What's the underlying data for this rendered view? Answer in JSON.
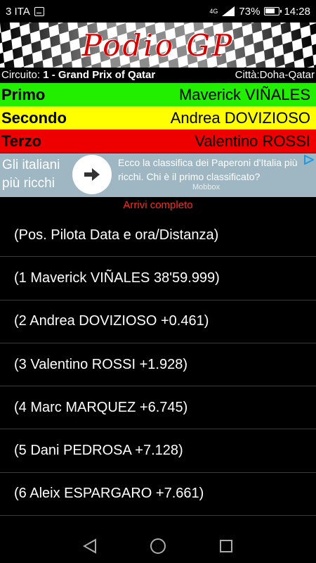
{
  "status_bar": {
    "carrier": "3 ITA",
    "network": "4G",
    "battery": "73%",
    "time": "14:28"
  },
  "header": {
    "title": "Podio GP"
  },
  "circuit": {
    "label": "Circuito: ",
    "name": "1 - Grand Prix of Qatar",
    "city": "Città:Doha-Qatar"
  },
  "podium": [
    {
      "position": "Primo",
      "rider": "Maverick VIÑALES",
      "color": "#22ee00"
    },
    {
      "position": "Secondo",
      "rider": "Andrea DOVIZIOSO",
      "color": "#ffff00"
    },
    {
      "position": "Terzo",
      "rider": "Valentino ROSSI",
      "color": "#ee0000"
    }
  ],
  "ad": {
    "left_text": "Gli italiani più ricchi",
    "body": "Ecco la classifica dei Paperoni d'Italia più ricchi. Chi è il primo classificato?",
    "brand": "Mobbox",
    "arrow_icon": "arrow-right-icon",
    "info_icon": "ad-choices-icon"
  },
  "results": {
    "title": "Arrivi completo",
    "rows": [
      "(Pos. Pilota Data e ora/Distanza)",
      "(1 Maverick VIÑALES 38'59.999)",
      "(2 Andrea DOVIZIOSO +0.461)",
      "(3 Valentino ROSSI +1.928)",
      "(4 Marc MARQUEZ +6.745)",
      "(5 Dani PEDROSA +7.128)",
      "(6 Aleix ESPARGARO +7.661)",
      ""
    ]
  },
  "colors": {
    "accent_red": "#ff2a1a",
    "ad_bg": "#9fb7c3"
  }
}
